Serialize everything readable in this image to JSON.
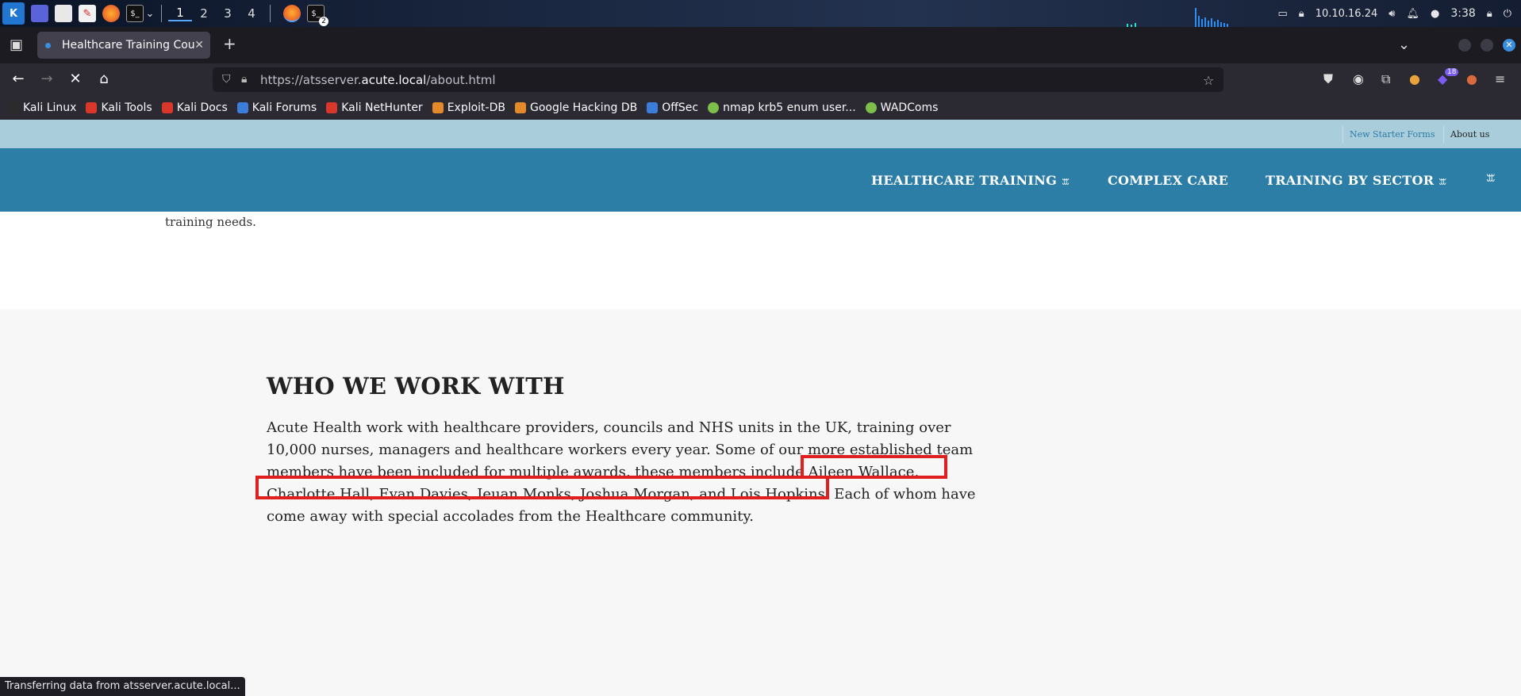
{
  "taskbar": {
    "workspaces": [
      "1",
      "2",
      "3",
      "4"
    ],
    "active_workspace": "1",
    "terminal_badge": "2",
    "ip": "10.10.16.24",
    "clock": "3:38"
  },
  "browser": {
    "tab_title": "Healthcare Training Cour",
    "url_prefix": "https://atsserver.",
    "url_host": "acute.local",
    "url_path": "/about.html",
    "extension_badge": "18",
    "bookmarks": [
      {
        "label": "Kali Linux",
        "color": "#2b2b2b"
      },
      {
        "label": "Kali Tools",
        "color": "#d9372b"
      },
      {
        "label": "Kali Docs",
        "color": "#d9372b"
      },
      {
        "label": "Kali Forums",
        "color": "#3b7dd8"
      },
      {
        "label": "Kali NetHunter",
        "color": "#d9372b"
      },
      {
        "label": "Exploit-DB",
        "color": "#e58a2b"
      },
      {
        "label": "Google Hacking DB",
        "color": "#e58a2b"
      },
      {
        "label": "OffSec",
        "color": "#3b7dd8"
      },
      {
        "label": "nmap krb5 enum user...",
        "color": "#7cc04b"
      },
      {
        "label": "WADComs",
        "color": "#7cc04b"
      }
    ],
    "status": "Transferring data from atsserver.acute.local..."
  },
  "site": {
    "top_links": {
      "new_starter": "New Starter Forms",
      "about": "About us"
    },
    "nav": {
      "healthcare": "HEALTHCARE TRAINING",
      "complex": "COMPLEX CARE",
      "sector": "TRAINING BY SECTOR",
      "caret": "ꕭ"
    },
    "prev_text": "training needs.",
    "section": {
      "heading": "WHO WE WORK WITH",
      "paragraph": "Acute Health work with healthcare providers, councils and NHS units in the UK, training over 10,000 nurses, managers and healthcare workers every year. Some of our more established team members have been included for multiple awards, these members include Aileen Wallace, Charlotte Hall, Evan Davies, Ieuan Monks, Joshua Morgan, and Lois Hopkins. Each of whom have come away with special accolades from the Healthcare community."
    }
  },
  "colors": {
    "highlight": "#e01f1f",
    "nav_bg": "#2c7ea6",
    "topbar_bg": "#aacddc"
  }
}
